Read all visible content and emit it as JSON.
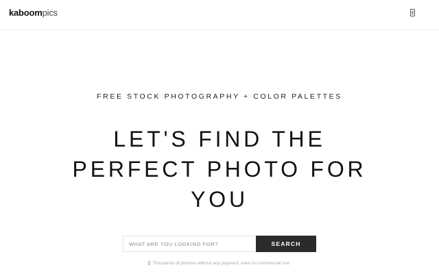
{
  "header": {
    "logo_bold": "kaboom",
    "logo_light": "pics",
    "menu_icon": "menu-icon"
  },
  "hero": {
    "tagline": "FREE STOCK PHOTOGRAPHY + COLOR PALETTES",
    "headline_lines": [
      "LET'S FIND THE",
      "PERFECT PHOTO FOR",
      "YOU"
    ]
  },
  "search": {
    "placeholder": "WHAT ARE YOU LOOKING FOR?",
    "value": "",
    "button_label": "SEARCH"
  },
  "footer_note": {
    "icon": "info-icon",
    "text": "Thousands of pictures without any payment, even for commercial use."
  },
  "colors": {
    "background": "#ffffff",
    "text": "#111111",
    "button": "#2b2b2b",
    "note": "#a9a9a9"
  }
}
